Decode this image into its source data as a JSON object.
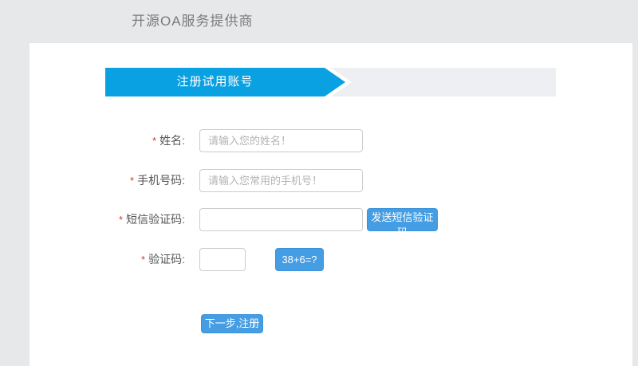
{
  "header": {
    "brand": "开源OA服务提供商"
  },
  "banner": {
    "title": "注册试用账号"
  },
  "form": {
    "fields": [
      {
        "required": "*",
        "label": "姓名:",
        "placeholder": "请输入您的姓名！",
        "value": ""
      },
      {
        "required": "*",
        "label": "手机号码:",
        "placeholder": "请输入您常用的手机号！",
        "value": ""
      },
      {
        "required": "*",
        "label": "短信验证码:",
        "placeholder": "",
        "value": "",
        "button_label": "发送短信验证码"
      },
      {
        "required": "*",
        "label": "验证码:",
        "placeholder": "",
        "value": "",
        "button_label": "38+6=?"
      }
    ],
    "submit_label": "下一步,注册"
  },
  "colors": {
    "accent_blue": "#0aa1e2",
    "button_blue": "#459de4",
    "banner_track_gray": "#edeff2",
    "required_red": "#d43c33",
    "page_background": "#e7e8ea"
  }
}
